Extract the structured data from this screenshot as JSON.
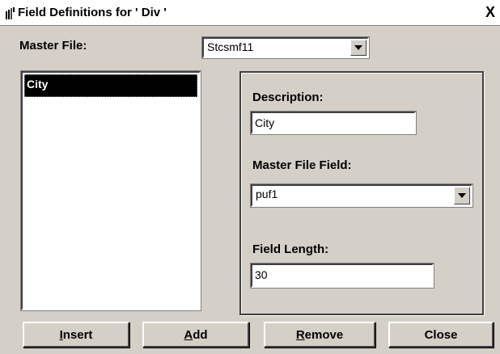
{
  "window": {
    "title": "Field Definitions for ' Div '",
    "close_glyph": "X"
  },
  "master_file": {
    "label": "Master File:",
    "value": "Stcsmf11"
  },
  "field_list": {
    "items": [
      "City"
    ],
    "selected_index": 0
  },
  "details": {
    "description_label": "Description:",
    "description_value": "City",
    "master_field_label": "Master File Field:",
    "master_field_value": "puf1",
    "length_label": "Field Length:",
    "length_value": "30"
  },
  "buttons": {
    "insert": {
      "mnemonic": "I",
      "rest": "nsert"
    },
    "add": {
      "mnemonic": "A",
      "rest": "dd"
    },
    "remove": {
      "mnemonic": "R",
      "rest": "emove"
    },
    "close": "Close"
  },
  "colors": {
    "dialog_bg": "#d4d0c8",
    "selection_bg": "#000000",
    "selection_fg": "#ffffff"
  }
}
